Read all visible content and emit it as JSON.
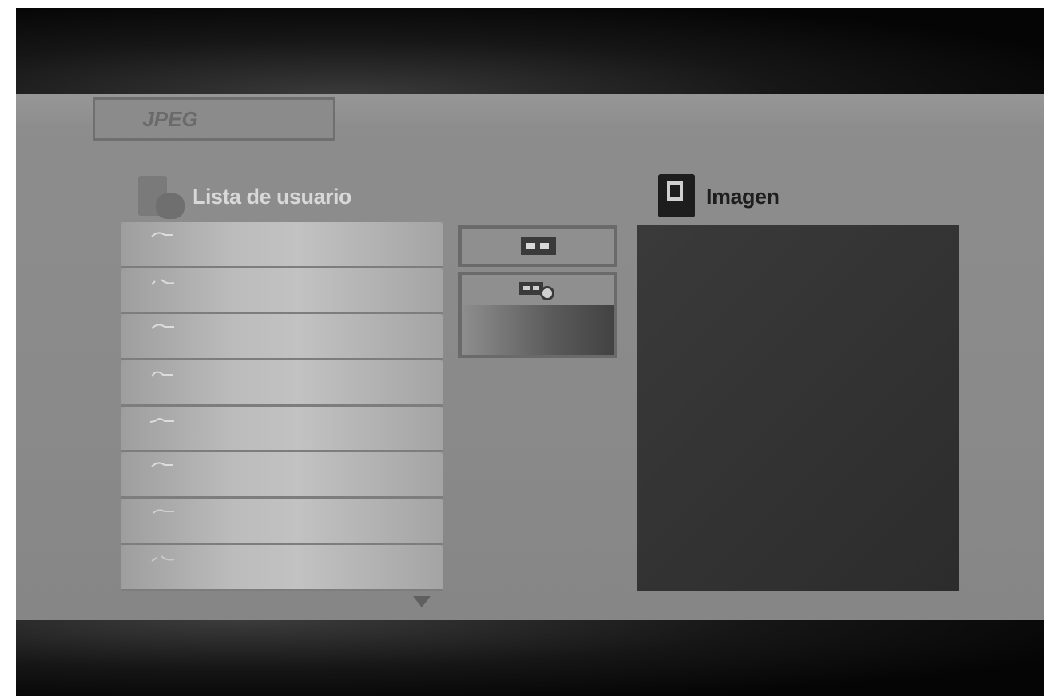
{
  "tab": {
    "label": "JPEG"
  },
  "list_section": {
    "title": "Lista de usuario",
    "icon": "folder-icon",
    "rows": [
      {
        "icon": "image-file-icon"
      },
      {
        "icon": "image-file-icon"
      },
      {
        "icon": "image-file-icon"
      },
      {
        "icon": "image-file-icon"
      },
      {
        "icon": "image-file-icon"
      },
      {
        "icon": "image-file-icon"
      },
      {
        "icon": "image-file-icon"
      },
      {
        "icon": "image-file-icon"
      }
    ],
    "scroll_icon": "scroll-down-arrow-icon"
  },
  "controls": {
    "play_icon": "play-icon",
    "slideshow_icon": "slideshow-timer-icon"
  },
  "preview_section": {
    "title": "Imagen",
    "icon": "picture-icon"
  },
  "colors": {
    "panel": "#8b8b8b",
    "preview": "#333333",
    "frame": "#0a0a0a"
  }
}
